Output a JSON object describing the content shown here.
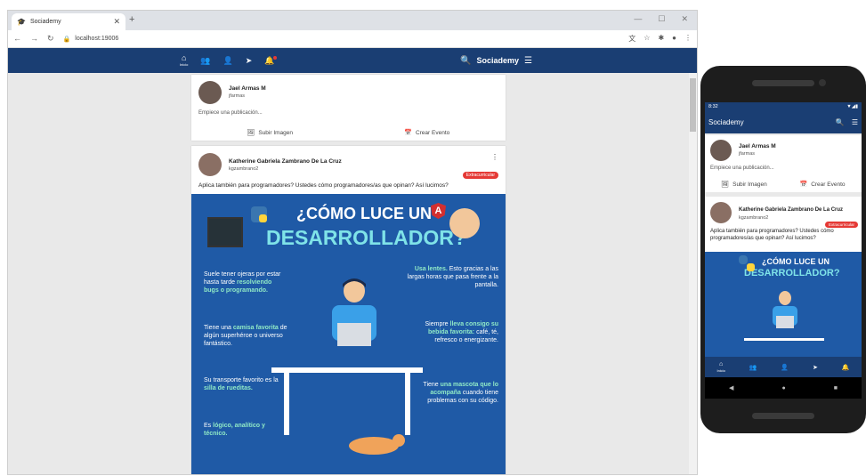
{
  "browser": {
    "tab_title": "Sociademy",
    "tab_close": "✕",
    "new_tab": "+",
    "url": "localhost:19006",
    "window_controls": [
      "—",
      "☐",
      "✕"
    ]
  },
  "app": {
    "brand": "Sociademy",
    "home_label": "Inicio",
    "nav_icons": [
      "home-icon",
      "groups-icon",
      "person-icon",
      "send-icon",
      "bell-icon"
    ]
  },
  "composer": {
    "user_name": "Jael Armas M",
    "user_handle": "jfarmas",
    "placeholder": "Empiece una publicación...",
    "upload_label": "Subir Imagen",
    "event_label": "Crear Evento"
  },
  "post": {
    "author": "Katherine Gabriela Zambrano De La Cruz",
    "handle": "kgzambrano2",
    "tag": "Extracurricular",
    "caption": "Aplica también para programadores? Ustedes cómo programadores/as que opinan? Así lucimos?",
    "infographic": {
      "title1": "¿CÓMO LUCE UN",
      "title2": "DESARROLLADOR?",
      "t1": "Suele tener ojeras por estar hasta tarde",
      "t1b": "resolviendo bugs",
      "t1c": "o programando.",
      "t2": "Tiene una",
      "t2b": "camisa favorita",
      "t2c": "de algún superhéroe o universo fantástico.",
      "t3": "Su transporte favorito es la",
      "t3b": "silla de rueditas.",
      "t4": "Es",
      "t4b": "lógico, analítico y técnico.",
      "t5b": "Usa lentes.",
      "t5": "Esto gracias a las largas horas que pasa frente a la pantalla.",
      "t6": "Siempre",
      "t6b": "lleva consigo su bebida favorita:",
      "t6c": "café, té, refresco o energizante.",
      "t7": "Tiene",
      "t7b": "una mascota que lo acompaña",
      "t7c": "cuando tiene problemas con su código."
    }
  },
  "phone": {
    "time": "8:32",
    "app_title": "Sociademy"
  },
  "colors": {
    "primary": "#1a3e73",
    "accent": "#e53935",
    "infographic": "#1f5aa6"
  }
}
